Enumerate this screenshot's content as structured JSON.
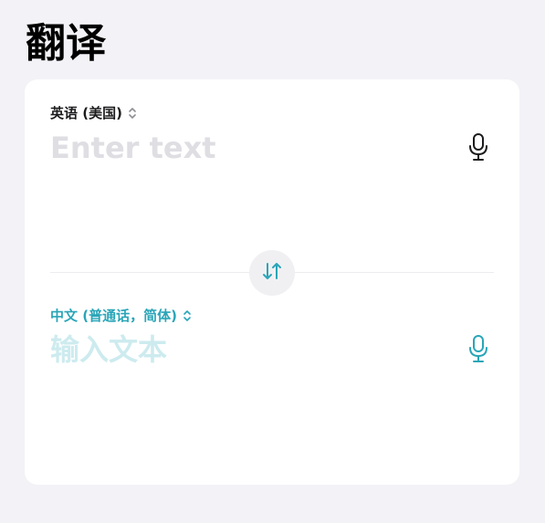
{
  "page": {
    "title": "翻译"
  },
  "colors": {
    "accent": "#2aa5b8",
    "source_text": "#1c1c1e",
    "icon_dark": "#1c1c1e"
  },
  "source": {
    "language": "英语 (美国)",
    "placeholder": "Enter text",
    "value": "",
    "language_icon": "chevron-up-down-icon",
    "mic_icon": "microphone-icon"
  },
  "swap": {
    "icon": "swap-arrows-icon"
  },
  "target": {
    "language": "中文 (普通话，简体)",
    "placeholder": "输入文本",
    "value": "",
    "language_icon": "chevron-up-down-icon",
    "mic_icon": "microphone-icon"
  }
}
